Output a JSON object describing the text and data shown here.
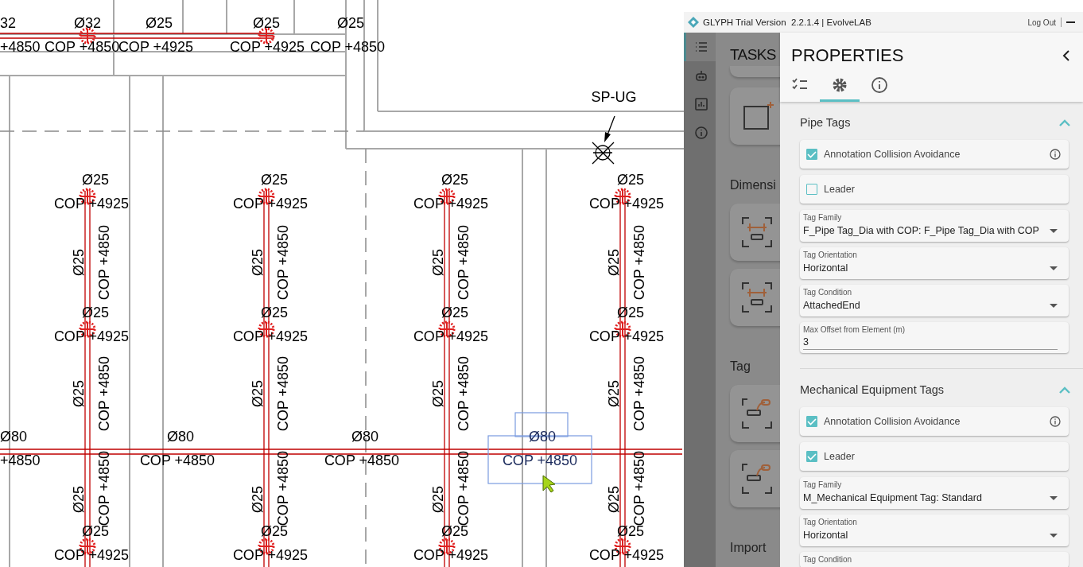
{
  "drawing": {
    "top_run": [
      {
        "diameter": "32",
        "cop": "+4850"
      },
      {
        "diameter": "Ø32",
        "cop": "COP +4850"
      },
      {
        "diameter": "Ø25",
        "cop": "COP +4925"
      },
      {
        "diameter": "Ø25",
        "cop": "COP +4925"
      },
      {
        "diameter": "Ø25",
        "cop": "COP +4850"
      }
    ],
    "riser_label": "SP-UG",
    "risers": [
      {
        "tags": [
          {
            "kind": "horizontal",
            "diameter": "Ø25",
            "cop": "COP +4925"
          },
          {
            "kind": "vertical",
            "diameter": "Ø25",
            "cop": "COP +4850"
          },
          {
            "kind": "horizontal",
            "diameter": "Ø25",
            "cop": "COP +4925"
          },
          {
            "kind": "vertical",
            "diameter": "Ø25",
            "cop": "COP +4850"
          },
          {
            "kind": "vertical",
            "diameter": "Ø25",
            "cop": "COP +4850"
          },
          {
            "kind": "horizontal",
            "diameter": "Ø25",
            "cop": "COP +4925"
          }
        ]
      },
      {
        "tags": [
          {
            "kind": "horizontal",
            "diameter": "Ø25",
            "cop": "COP +4925"
          },
          {
            "kind": "vertical",
            "diameter": "Ø25",
            "cop": "COP +4850"
          },
          {
            "kind": "horizontal",
            "diameter": "Ø25",
            "cop": "COP +4925"
          },
          {
            "kind": "vertical",
            "diameter": "Ø25",
            "cop": "COP +4850"
          },
          {
            "kind": "vertical",
            "diameter": "Ø25",
            "cop": "COP +4850"
          },
          {
            "kind": "horizontal",
            "diameter": "Ø25",
            "cop": "COP +4925"
          }
        ]
      },
      {
        "tags": [
          {
            "kind": "horizontal",
            "diameter": "Ø25",
            "cop": "COP +4925"
          },
          {
            "kind": "vertical",
            "diameter": "Ø25",
            "cop": "COP +4850"
          },
          {
            "kind": "horizontal",
            "diameter": "Ø25",
            "cop": "COP +4925"
          },
          {
            "kind": "vertical",
            "diameter": "Ø25",
            "cop": "COP +4850"
          },
          {
            "kind": "vertical",
            "diameter": "Ø25",
            "cop": "COP +4850"
          },
          {
            "kind": "horizontal",
            "diameter": "Ø25",
            "cop": "COP +4925"
          }
        ]
      },
      {
        "tags": [
          {
            "kind": "horizontal",
            "diameter": "Ø25",
            "cop": "COP +4925"
          },
          {
            "kind": "vertical",
            "diameter": "Ø25",
            "cop": "COP +4850"
          },
          {
            "kind": "horizontal",
            "diameter": "Ø25",
            "cop": "COP +4925"
          },
          {
            "kind": "vertical",
            "diameter": "Ø25",
            "cop": "COP +4850"
          },
          {
            "kind": "vertical",
            "diameter": "Ø25",
            "cop": "COP +4850"
          },
          {
            "kind": "horizontal",
            "diameter": "Ø25",
            "cop": "COP +4925"
          }
        ]
      }
    ],
    "main_run": [
      {
        "diameter": "Ø80",
        "cop": "+4850",
        "selected": false
      },
      {
        "diameter": "Ø80",
        "cop": "COP +4850",
        "selected": false
      },
      {
        "diameter": "Ø80",
        "cop": "COP +4850",
        "selected": false
      },
      {
        "diameter": "Ø80",
        "cop": "COP +4850",
        "selected": true
      }
    ]
  },
  "window": {
    "title": "GLYPH Trial Version  2.2.1.4 | EvolveLAB",
    "log_out": "Log Out"
  },
  "rail": [
    {
      "kind": "list",
      "selected": true
    },
    {
      "kind": "robot",
      "selected": false
    },
    {
      "kind": "chart",
      "selected": false
    },
    {
      "kind": "info",
      "selected": false
    }
  ],
  "tasks": {
    "title": "TASKS",
    "headings": [
      "Dimensi",
      "Tag",
      "Import"
    ]
  },
  "properties": {
    "title": "PROPERTIES",
    "tabs": [
      {
        "kind": "checklist",
        "selected": false
      },
      {
        "kind": "gear",
        "selected": true
      },
      {
        "kind": "info",
        "selected": false
      }
    ],
    "sections": [
      {
        "title": "Pipe Tags",
        "expanded": true,
        "items": [
          {
            "kind": "checkbox",
            "label": "Annotation Collision Avoidance",
            "checked": true,
            "info": true
          },
          {
            "kind": "checkbox",
            "label": "Leader",
            "checked": false,
            "info": false
          },
          {
            "kind": "select",
            "label": "Tag Family",
            "value": "F_Pipe Tag_Dia with COP: F_Pipe Tag_Dia with COP"
          },
          {
            "kind": "select",
            "label": "Tag Orientation",
            "value": "Horizontal"
          },
          {
            "kind": "select",
            "label": "Tag Condition",
            "value": "AttachedEnd"
          },
          {
            "kind": "input",
            "label": "Max Offset from Element (m)",
            "value": "3"
          }
        ]
      },
      {
        "title": "Mechanical Equipment Tags",
        "expanded": true,
        "items": [
          {
            "kind": "checkbox",
            "label": "Annotation Collision Avoidance",
            "checked": true,
            "info": true
          },
          {
            "kind": "checkbox",
            "label": "Leader",
            "checked": true,
            "info": false
          },
          {
            "kind": "select",
            "label": "Tag Family",
            "value": "M_Mechanical Equipment Tag: Standard"
          },
          {
            "kind": "select",
            "label": "Tag Orientation",
            "value": "Horizontal"
          },
          {
            "kind": "select",
            "label": "Tag Condition"
          }
        ]
      }
    ]
  }
}
